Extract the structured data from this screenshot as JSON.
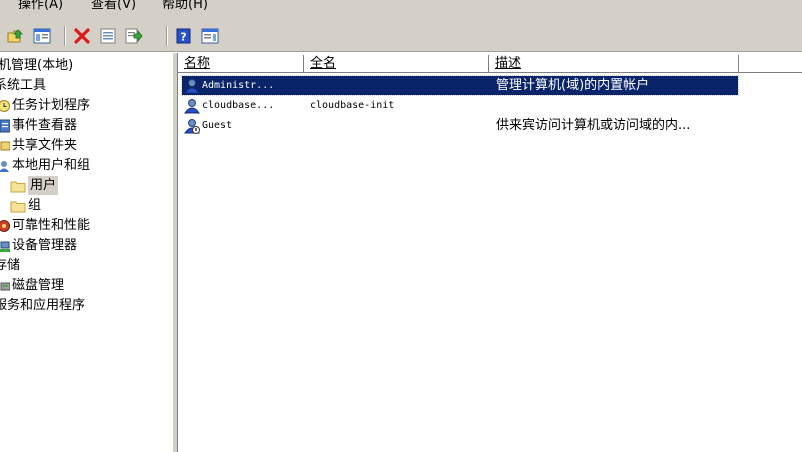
{
  "menubar": {
    "items": [
      {
        "label": "操作(A)"
      },
      {
        "label": "查看(V)"
      },
      {
        "label": "帮助(H)"
      }
    ]
  },
  "toolbar": {
    "buttons": [
      {
        "icon": "up-folder-icon"
      },
      {
        "icon": "show-hide-tree-icon"
      },
      {
        "icon": "delete-icon"
      },
      {
        "icon": "properties-icon"
      },
      {
        "icon": "export-list-icon"
      },
      {
        "icon": "help-icon"
      },
      {
        "icon": "show-hide-action-pane-icon"
      }
    ]
  },
  "tree": {
    "items": [
      {
        "label": "机管理(本地)"
      },
      {
        "label": "系统工具"
      },
      {
        "label": "任务计划程序"
      },
      {
        "label": "事件查看器"
      },
      {
        "label": "共享文件夹"
      },
      {
        "label": "本地用户和组"
      },
      {
        "label": "用户"
      },
      {
        "label": "组"
      },
      {
        "label": "可靠性和性能"
      },
      {
        "label": "设备管理器"
      },
      {
        "label": "存储"
      },
      {
        "label": "磁盘管理"
      },
      {
        "label": "服务和应用程序"
      }
    ]
  },
  "list": {
    "columns": [
      {
        "label": "名称"
      },
      {
        "label": "全名"
      },
      {
        "label": "描述"
      }
    ],
    "rows": [
      {
        "name": "Administr...",
        "fullname": "",
        "description": "管理计算机(域)的内置帐户",
        "selected": true
      },
      {
        "name": "cloudbase...",
        "fullname": "cloudbase-init",
        "description": "",
        "selected": false
      },
      {
        "name": "Guest",
        "fullname": "",
        "description": "供来宾访问计算机或访问域的内...",
        "selected": false
      }
    ]
  },
  "colors": {
    "chrome": "#d4d0c8",
    "selection": "#0a246a",
    "selection_text": "#ffffff"
  }
}
